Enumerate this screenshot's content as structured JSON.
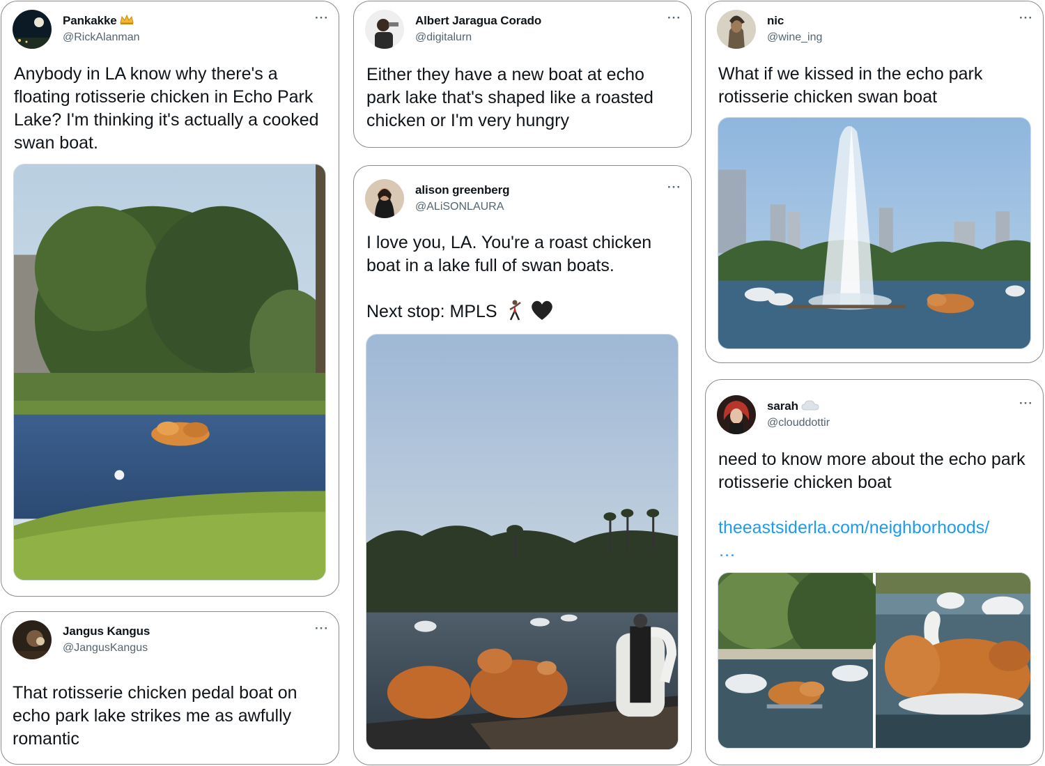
{
  "tweets": [
    {
      "name": "Pankakke",
      "name_badge_icon": "crown-icon",
      "handle": "@RickAlanman",
      "text": "Anybody in LA know why there's a floating rotisserie chicken in Echo Park Lake? I'm thinking it's actually a cooked swan boat."
    },
    {
      "name": "Jangus Kangus",
      "handle": "@JangusKangus",
      "text": "That rotisserie chicken pedal boat on echo park lake strikes me as awfully romantic"
    },
    {
      "name": "Albert Jaragua Corado",
      "handle": "@digitalurn",
      "text": "Either they have a new boat at echo park lake that's shaped like a roasted chicken or I'm very hungry"
    },
    {
      "name": "alison greenberg",
      "handle": "@ALiSONLAURA",
      "text_line1": "I love you, LA. You're a roast chicken boat in a lake full of swan boats.",
      "text_line2": "Next stop: MPLS",
      "emoji_icons": [
        "dancer-icon",
        "black-heart-icon"
      ]
    },
    {
      "name": "nic",
      "handle": "@wine_ing",
      "text": "What if we kissed in the echo park rotisserie chicken swan boat"
    },
    {
      "name": "sarah",
      "name_badge_icon": "cloud-icon",
      "handle": "@clouddottir",
      "text": "need to know more about the echo park rotisserie chicken boat",
      "link": "theeastsiderla.com/neighborhoods/",
      "link_ellipsis": "…"
    }
  ],
  "more_label": "···",
  "colors": {
    "link": "#1d9bf0",
    "handle": "#536471",
    "card_border": "#8a8a8a"
  }
}
